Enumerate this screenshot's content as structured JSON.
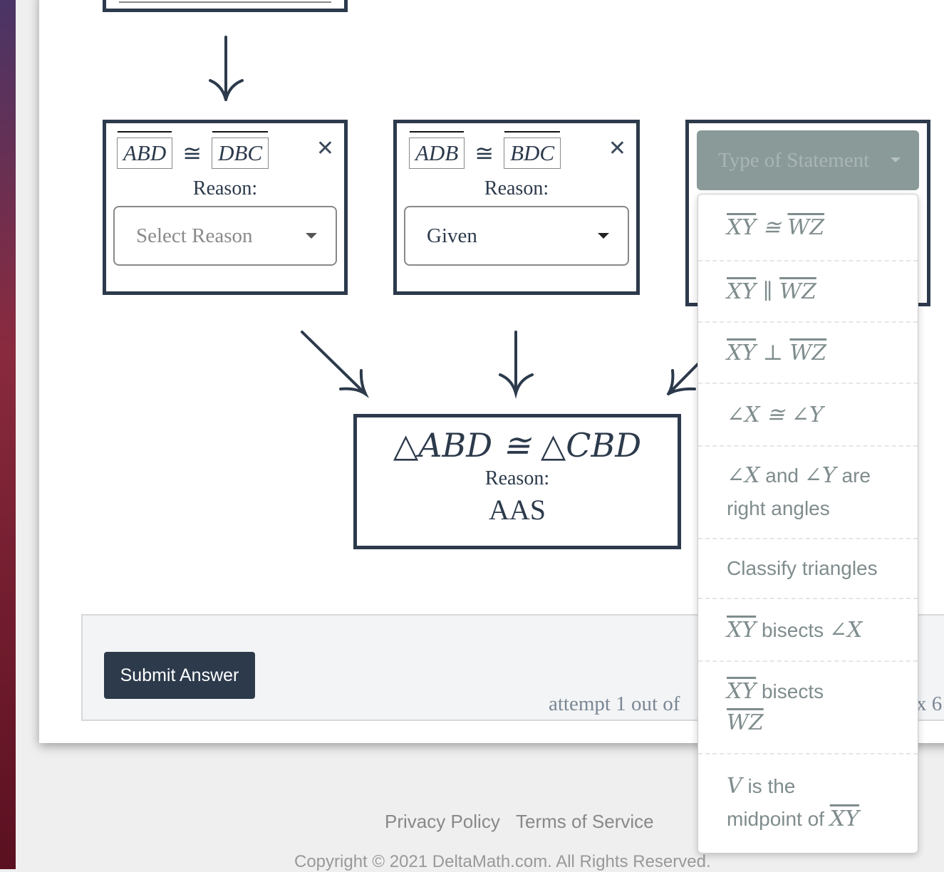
{
  "statements": [
    {
      "left": "ABD",
      "right": "DBC",
      "relation": "≅",
      "reason_label": "Reason:",
      "reason": "Select Reason",
      "reason_is_placeholder": true
    },
    {
      "left": "ADB",
      "right": "BDC",
      "relation": "≅",
      "reason_label": "Reason:",
      "reason": "Given",
      "reason_is_placeholder": false
    }
  ],
  "type_dropdown": {
    "placeholder": "Type of Statement",
    "options": [
      "XY ≅ WZ",
      "XY ∥ WZ",
      "XY ⊥ WZ",
      "∠X ≅ ∠Y",
      "∠X and ∠Y are right angles",
      "Classify triangles",
      "XY bisects ∠X",
      "XY bisects WZ",
      "V is the midpoint of XY"
    ]
  },
  "conclusion": {
    "statement": "△ABD ≅ △CBD",
    "reason_label": "Reason:",
    "reason": "AAS"
  },
  "footer_bar": {
    "submit": "Submit Answer",
    "attempt": "attempt 1 out of",
    "attempt_right": "x 6"
  },
  "site_footer": {
    "privacy": "Privacy Policy",
    "terms": "Terms of Service",
    "copyright": "Copyright © 2021 DeltaMath.com. All Rights Reserved."
  },
  "colors": {
    "navy": "#2c3a4b",
    "dropdown_button": "#8a9a99",
    "menu_text": "#7f8c8d"
  }
}
